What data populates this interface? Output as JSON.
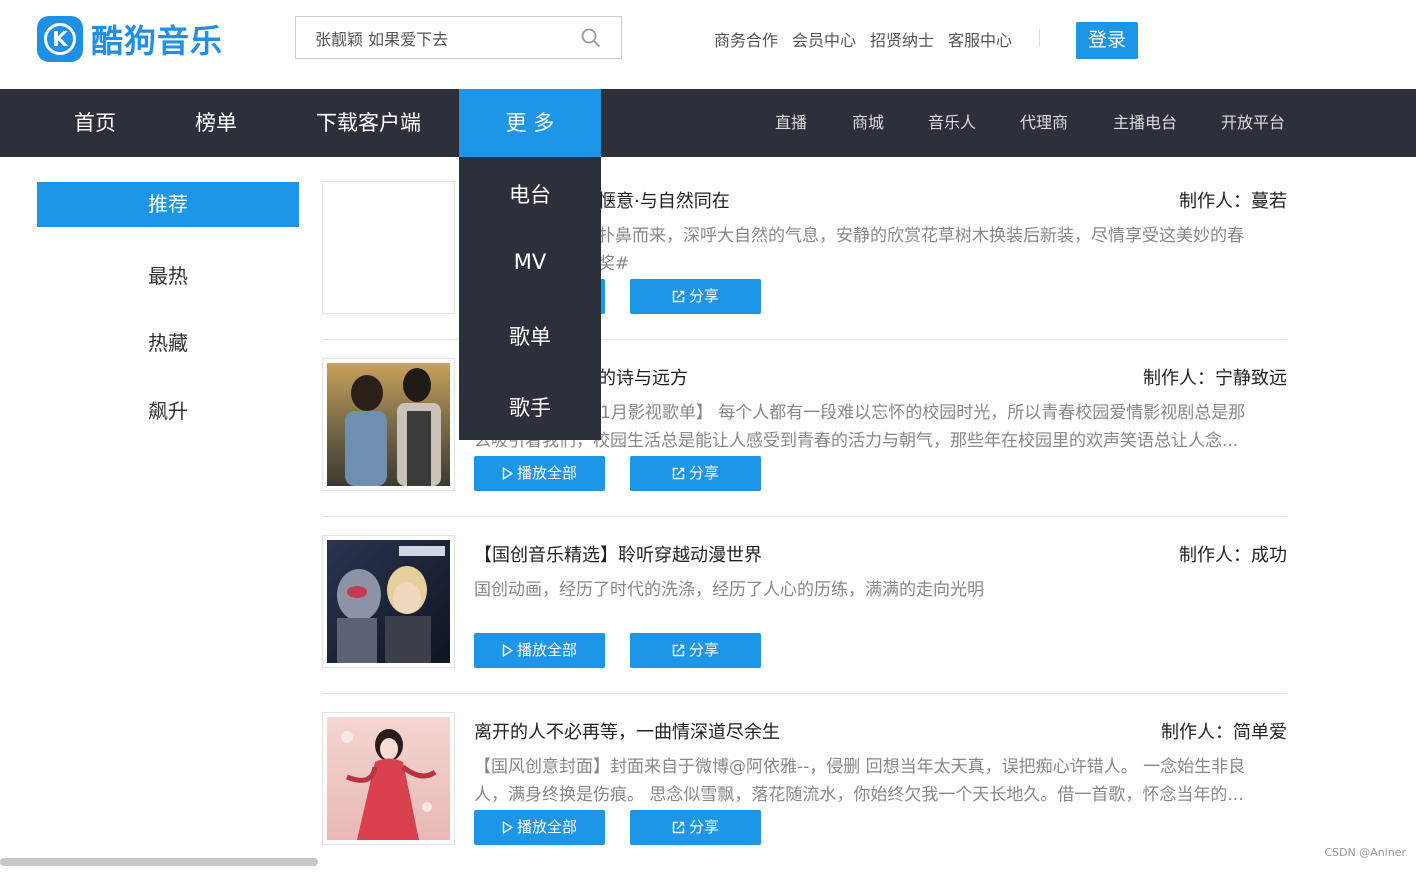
{
  "brand": {
    "logo_text": "酷狗音乐",
    "badge_letter": "K",
    "color": "#1e90e8"
  },
  "search": {
    "value": "张靓颖 如果爱下去",
    "icon": "search-icon"
  },
  "top_links": [
    "商务合作",
    "会员中心",
    "招贤纳士",
    "客服中心"
  ],
  "login_label": "登录",
  "nav": {
    "main": [
      "首页",
      "榜单",
      "下载客户端"
    ],
    "more_label": "更 多",
    "right": [
      "直播",
      "商城",
      "音乐人",
      "代理商",
      "主播电台",
      "开放平台"
    ],
    "more_dropdown": [
      "电台",
      "MV",
      "歌单",
      "歌手"
    ]
  },
  "sidebar": {
    "active": "推荐",
    "items": [
      "最热",
      "热藏",
      "飙升"
    ]
  },
  "cards": [
    {
      "title_visible": "惬意·与自然同在",
      "maker": "制作人：蔓若",
      "desc_line1": "扑鼻而来，深呼大自然的气息，安静的欣赏花草树木换装后新装，尽情享受这美妙的春",
      "desc_line2": "奖#",
      "share_label": "分享"
    },
    {
      "title_visible": "的诗与远方",
      "maker": "制作人：宁静致远",
      "desc_line1": "1月影视歌单】 每个人都有一段难以忘怀的校园时光，所以青春校园爱情影视剧总是那",
      "desc_line2": "么吸引着我们，校园生活总是能让人感受到青春的活力与朝气，那些年在校园里的欢声笑语总让人念...",
      "play_label": "播放全部",
      "share_label": "分享"
    },
    {
      "title": "【国创音乐精选】聆听穿越动漫世界",
      "maker": "制作人：成功",
      "desc": "国创动画，经历了时代的洗涤，经历了人心的历练，满满的走向光明",
      "play_label": "播放全部",
      "share_label": "分享"
    },
    {
      "title": "离开的人不必再等，一曲情深道尽余生",
      "maker": "制作人：简单爱",
      "desc": "【国风创意封面】封面来自于微博@阿依雅--，侵删 回想当年太天真，误把痴心许错人。 一念始生非良人，满身终换是伤痕。 思念似雪飘，落花随流水，你始终欠我一个天长地久。借一首歌，怀念当年的...",
      "play_label": "播放全部",
      "share_label": "分享"
    }
  ],
  "watermark": "CSDN @Anlner"
}
